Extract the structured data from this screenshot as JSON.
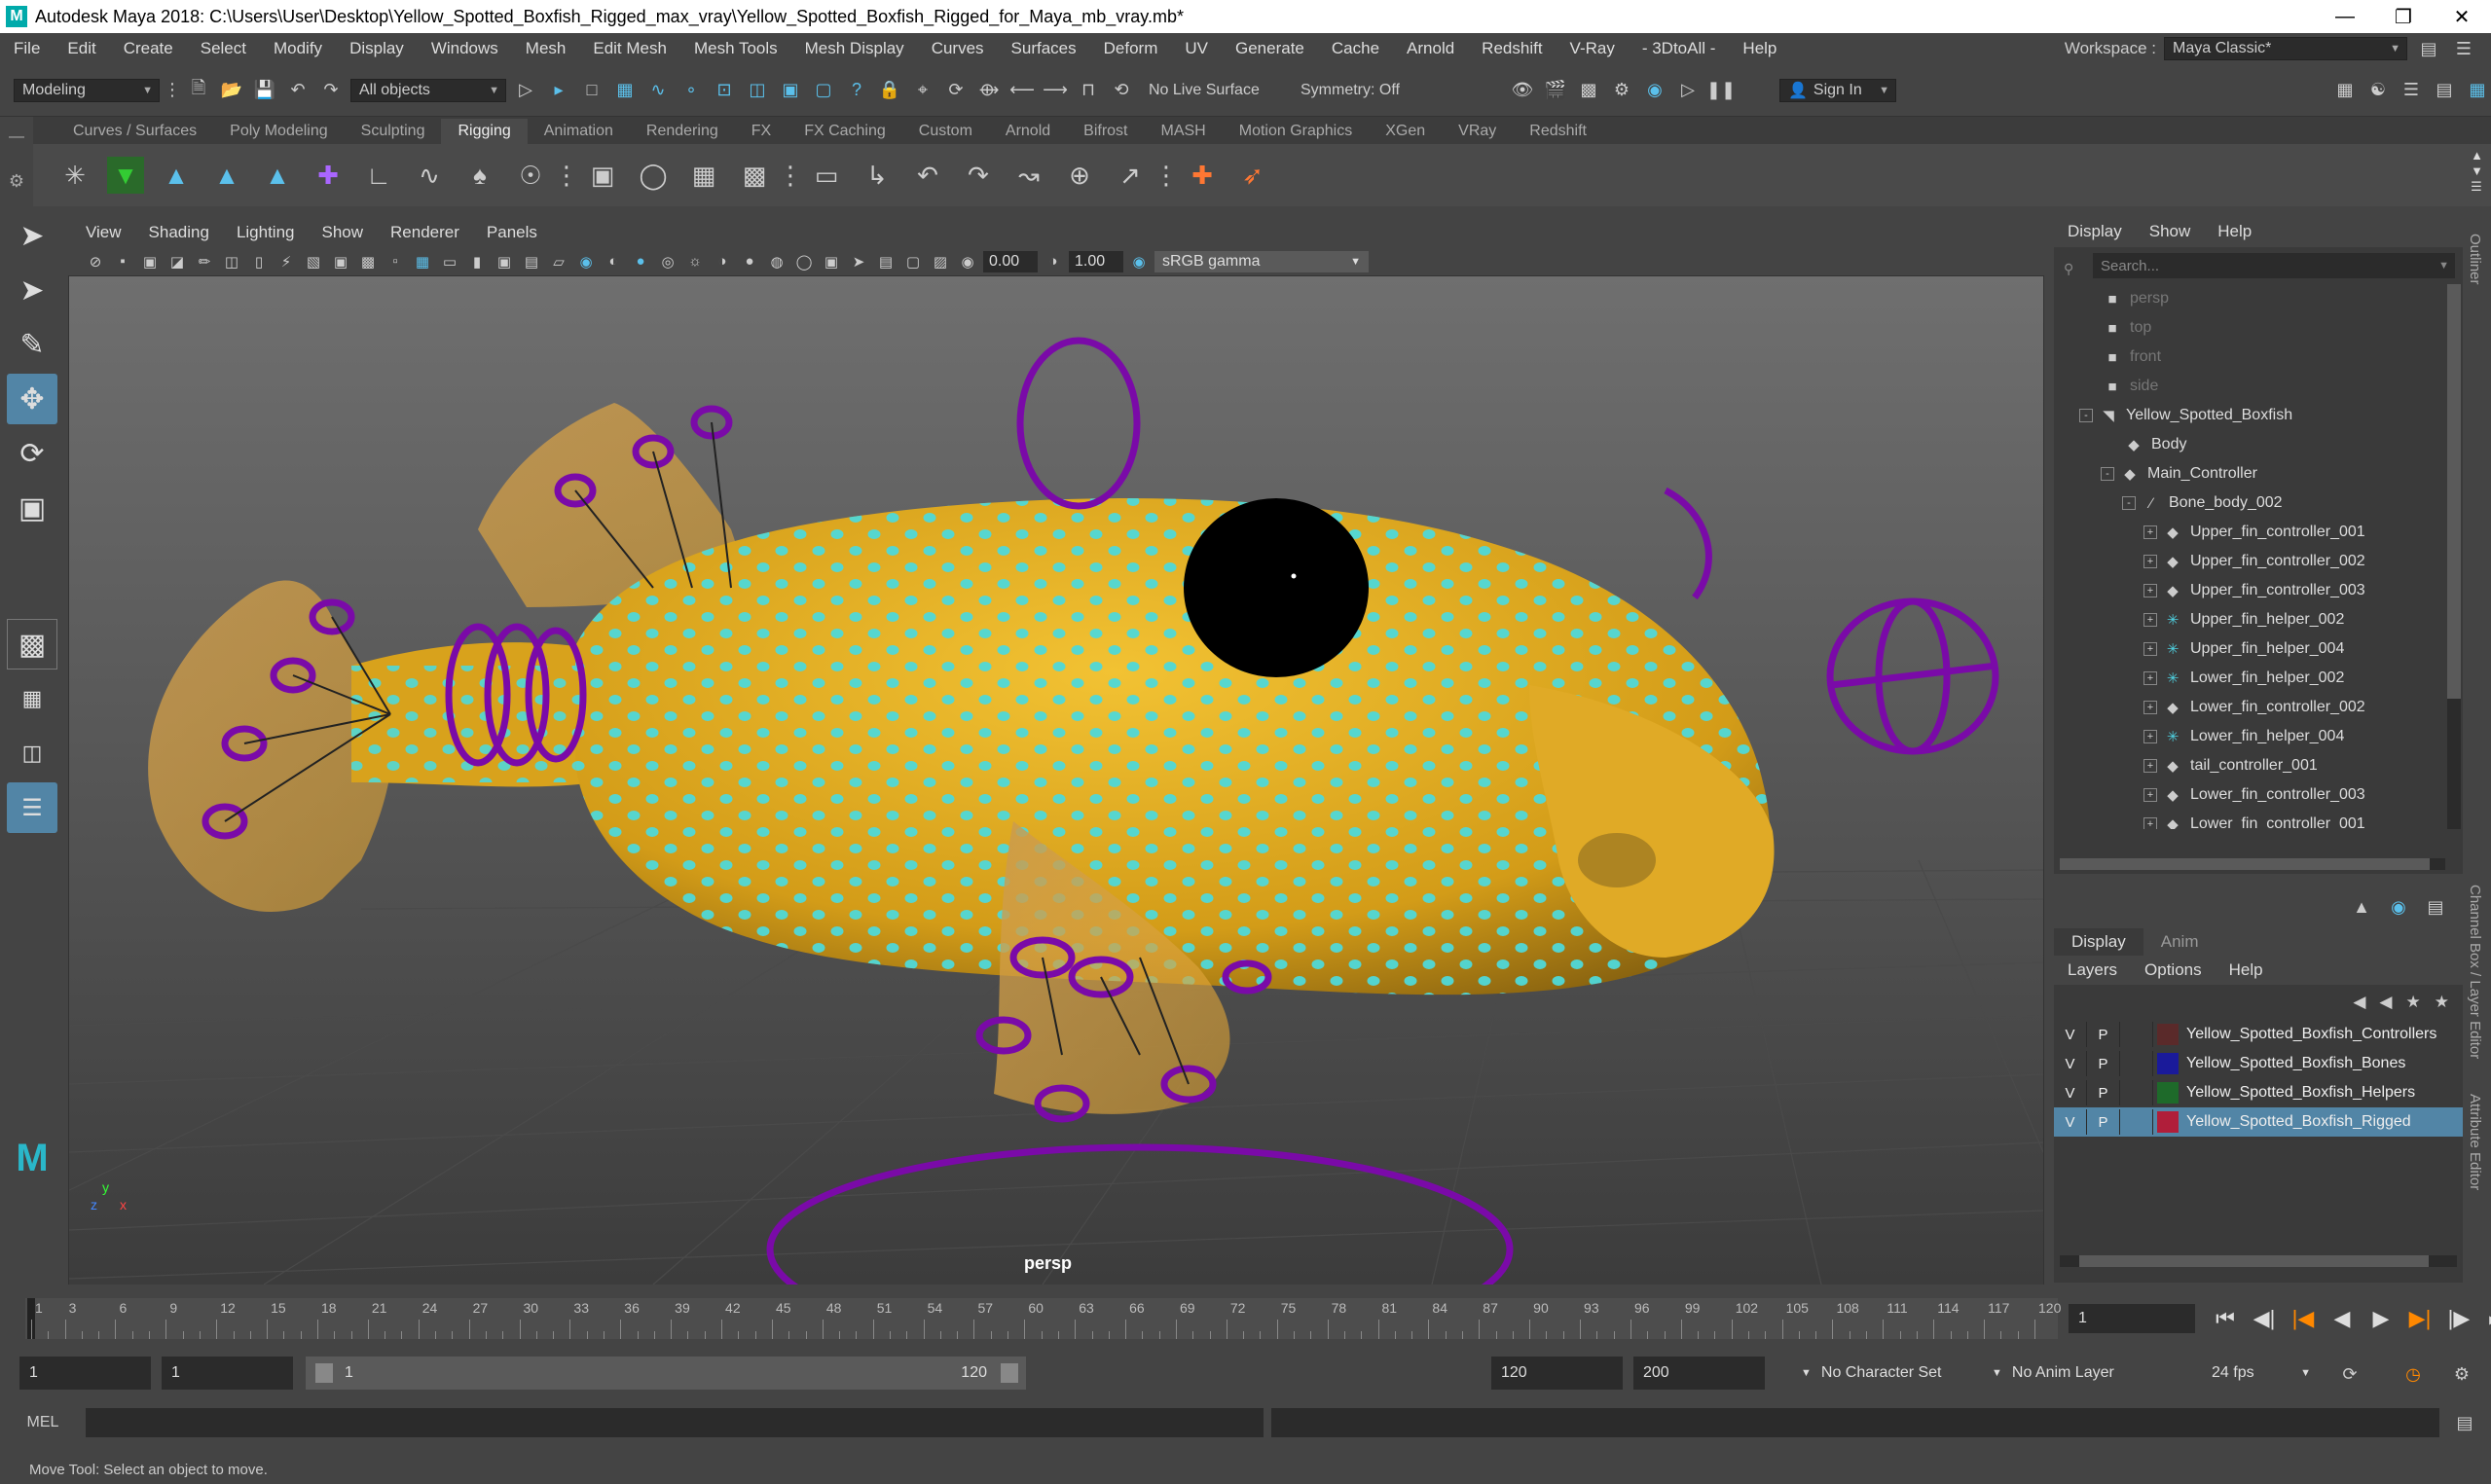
{
  "window": {
    "title": "Autodesk Maya 2018: C:\\Users\\User\\Desktop\\Yellow_Spotted_Boxfish_Rigged_max_vray\\Yellow_Spotted_Boxfish_Rigged_for_Maya_mb_vray.mb*"
  },
  "menubar": [
    "File",
    "Edit",
    "Create",
    "Select",
    "Modify",
    "Display",
    "Windows",
    "Mesh",
    "Edit Mesh",
    "Mesh Tools",
    "Mesh Display",
    "Curves",
    "Surfaces",
    "Deform",
    "UV",
    "Generate",
    "Cache",
    "Arnold",
    "Redshift",
    "V-Ray",
    "- 3DtoAll -",
    "Help"
  ],
  "workspace": {
    "label": "Workspace :",
    "value": "Maya Classic*"
  },
  "statusline": {
    "mode": "Modeling",
    "selection": "All objects",
    "live_surface": "No Live Surface",
    "symmetry": "Symmetry: Off",
    "signin": "Sign In"
  },
  "shelf_tabs": [
    "Curves / Surfaces",
    "Poly Modeling",
    "Sculpting",
    "Rigging",
    "Animation",
    "Rendering",
    "FX",
    "FX Caching",
    "Custom",
    "Arnold",
    "Bifrost",
    "MASH",
    "Motion Graphics",
    "XGen",
    "VRay",
    "Redshift"
  ],
  "active_shelf_tab": "Rigging",
  "viewport": {
    "menu": [
      "View",
      "Shading",
      "Lighting",
      "Show",
      "Renderer",
      "Panels"
    ],
    "exposure": "0.00",
    "gamma_value": "1.00",
    "color_space": "sRGB gamma",
    "camera": "persp",
    "axis_y": "y",
    "axis_x": "x",
    "axis_z": "z"
  },
  "outliner": {
    "menu": [
      "Display",
      "Show",
      "Help"
    ],
    "search_placeholder": "Search...",
    "items": [
      {
        "label": "persp",
        "indent": 0,
        "icon": "camera-icon",
        "dim": true
      },
      {
        "label": "top",
        "indent": 0,
        "icon": "camera-icon",
        "dim": true
      },
      {
        "label": "front",
        "indent": 0,
        "icon": "camera-icon",
        "dim": true
      },
      {
        "label": "side",
        "indent": 0,
        "icon": "camera-icon",
        "dim": true
      },
      {
        "label": "Yellow_Spotted_Boxfish",
        "indent": 0,
        "icon": "mesh-icon",
        "expander": "-"
      },
      {
        "label": "Body",
        "indent": 1,
        "icon": "transform-icon"
      },
      {
        "label": "Main_Controller",
        "indent": 1,
        "icon": "transform-icon",
        "expander": "-"
      },
      {
        "label": "Bone_body_002",
        "indent": 2,
        "icon": "joint-icon",
        "expander": "-"
      },
      {
        "label": "Upper_fin_controller_001",
        "indent": 3,
        "icon": "transform-icon",
        "expander": "+"
      },
      {
        "label": "Upper_fin_controller_002",
        "indent": 3,
        "icon": "transform-icon",
        "expander": "+"
      },
      {
        "label": "Upper_fin_controller_003",
        "indent": 3,
        "icon": "transform-icon",
        "expander": "+"
      },
      {
        "label": "Upper_fin_helper_002",
        "indent": 3,
        "icon": "helper-icon",
        "expander": "+"
      },
      {
        "label": "Upper_fin_helper_004",
        "indent": 3,
        "icon": "helper-icon",
        "expander": "+"
      },
      {
        "label": "Lower_fin_helper_002",
        "indent": 3,
        "icon": "helper-icon",
        "expander": "+"
      },
      {
        "label": "Lower_fin_controller_002",
        "indent": 3,
        "icon": "transform-icon",
        "expander": "+"
      },
      {
        "label": "Lower_fin_helper_004",
        "indent": 3,
        "icon": "helper-icon",
        "expander": "+"
      },
      {
        "label": "tail_controller_001",
        "indent": 3,
        "icon": "transform-icon",
        "expander": "+"
      },
      {
        "label": "Lower_fin_controller_003",
        "indent": 3,
        "icon": "transform-icon",
        "expander": "+"
      },
      {
        "label": "Lower_fin_controller_001",
        "indent": 3,
        "icon": "transform-icon",
        "expander": "+"
      }
    ]
  },
  "layer_editor": {
    "tabs": [
      "Display",
      "Anim"
    ],
    "active_tab": "Display",
    "menu": [
      "Layers",
      "Options",
      "Help"
    ],
    "layers": [
      {
        "v": "V",
        "p": "P",
        "color": "#5a2a2a",
        "name": "Yellow_Spotted_Boxfish_Controllers",
        "selected": false
      },
      {
        "v": "V",
        "p": "P",
        "color": "#1a1a9a",
        "name": "Yellow_Spotted_Boxfish_Bones",
        "selected": false
      },
      {
        "v": "V",
        "p": "P",
        "color": "#1e6a2a",
        "name": "Yellow_Spotted_Boxfish_Helpers",
        "selected": false
      },
      {
        "v": "V",
        "p": "P",
        "color": "#b01e3a",
        "name": "Yellow_Spotted_Boxfish_Rigged",
        "selected": true
      }
    ]
  },
  "side_tabs": [
    "Outliner",
    "Channel Box / Layer Editor",
    "Attribute Editor"
  ],
  "timeline": {
    "ticks": [
      "1",
      "3",
      "6",
      "9",
      "12",
      "15",
      "18",
      "21",
      "24",
      "27",
      "30",
      "33",
      "36",
      "39",
      "42",
      "45",
      "48",
      "51",
      "54",
      "57",
      "60",
      "63",
      "66",
      "69",
      "72",
      "75",
      "78",
      "81",
      "84",
      "87",
      "90",
      "93",
      "96",
      "99",
      "102",
      "105",
      "108",
      "111",
      "114",
      "117",
      "120"
    ],
    "current_frame": "1"
  },
  "range": {
    "start": "1",
    "playback_start": "1",
    "slider_start": "1",
    "slider_end": "120",
    "playback_end": "120",
    "end": "200",
    "character_set": "No Character Set",
    "anim_layer": "No Anim Layer",
    "fps": "24 fps"
  },
  "command_line": {
    "label": "MEL"
  },
  "help_line": "Move Tool: Select an object to move.",
  "colors": {
    "accent": "#5285a6",
    "fish": "#e0a81c",
    "spots": "#4fd8d8",
    "rig": "#7a0aa8"
  }
}
